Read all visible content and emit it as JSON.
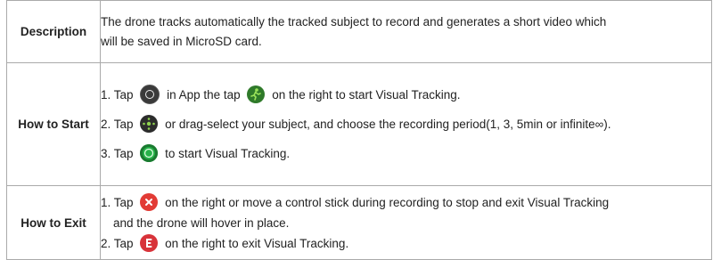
{
  "rows": {
    "description": {
      "label": "Description",
      "line1": "The drone tracks automatically the tracked subject to record and generates a short video which",
      "line2": "will be saved in MicroSD card."
    },
    "how_to_start": {
      "label": "How to Start",
      "step1_a": "1. Tap",
      "step1_b": "in App the tap",
      "step1_c": "on the right to start Visual Tracking.",
      "step2_a": "2. Tap",
      "step2_b": "or drag-select your subject, and choose the recording period(1, 3, 5min or infinite∞).",
      "step3_a": "3. Tap",
      "step3_b": "to start Visual Tracking."
    },
    "how_to_exit": {
      "label": "How to Exit",
      "step1_a": "1. Tap",
      "step1_b": "on the right or move a control stick during recording to stop and exit Visual Tracking",
      "step1_c": "and the drone will hover in place.",
      "step2_a": "2. Tap",
      "step2_b": "on the right to exit Visual Tracking."
    }
  },
  "icons": {
    "dpad": "dpad-icon",
    "runner": "running-person-icon",
    "select": "target-select-icon",
    "go": "go-button-icon",
    "stop": "stop-x-icon",
    "exit": "exit-e-icon"
  },
  "colors": {
    "go_green": "#27b24a",
    "stop_red": "#e23b35",
    "runner_green": "#2f7a2a"
  }
}
